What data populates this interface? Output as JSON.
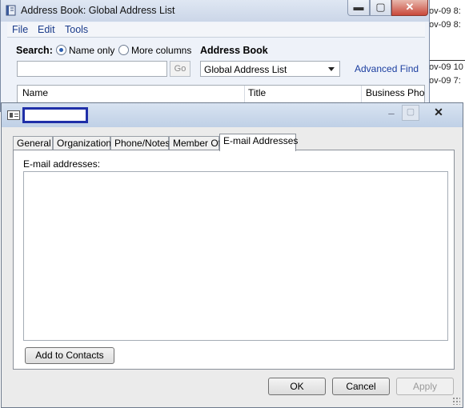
{
  "background_list": {
    "rows": [
      "ov-09 8:",
      "ov-09 8:",
      "ov-09 10",
      "ov-09 7:"
    ]
  },
  "address_book": {
    "title": "Address Book: Global Address List",
    "menu": [
      "File",
      "Edit",
      "Tools"
    ],
    "search_label": "Search:",
    "radio_name_only": "Name only",
    "radio_more_columns": "More columns",
    "address_book_label": "Address Book",
    "search_value": "",
    "go_label": "Go",
    "selected_book": "Global Address List",
    "advanced_find": "Advanced Find",
    "columns": [
      "Name",
      "Title",
      "Business Phone"
    ]
  },
  "dialog": {
    "title": "",
    "tabs": [
      "General",
      "Organization",
      "Phone/Notes",
      "Member Of",
      "E-mail Addresses"
    ],
    "active_tab": "E-mail Addresses",
    "email_label": "E-mail addresses:",
    "add_to_contacts": "Add to Contacts",
    "ok": "OK",
    "cancel": "Cancel",
    "apply": "Apply"
  },
  "icons": {
    "address_book": "address-book-icon",
    "contact_card": "contact-card-icon",
    "minimize": "minimize-icon",
    "maximize": "maximize-icon",
    "close": "close-icon",
    "dropdown": "chevron-down-icon"
  }
}
